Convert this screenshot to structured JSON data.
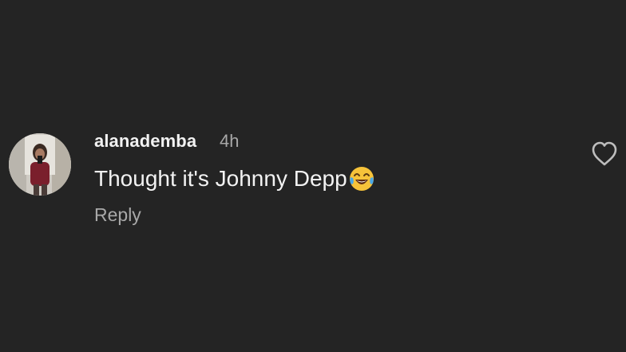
{
  "comment": {
    "username": "alanademba",
    "time": "4h",
    "text": "Thought it's Johnny Depp",
    "emoji": "face-with-tears-of-joy-icon",
    "reply_label": "Reply",
    "like_icon": "heart-outline-icon"
  },
  "colors": {
    "background": "#242424",
    "primary_text": "#f2f2f2",
    "secondary_text": "#a8a8a8",
    "icon": "#bdbdbd"
  }
}
